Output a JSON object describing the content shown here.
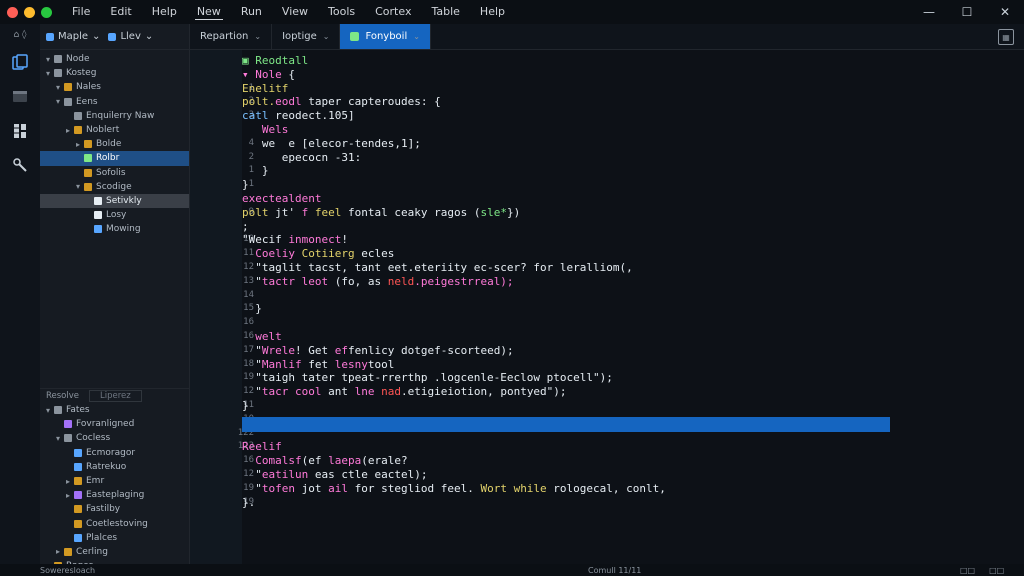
{
  "titlebar": {
    "menus": [
      "File",
      "Edit",
      "Help",
      "New",
      "Run",
      "View",
      "Tools",
      "Cortex",
      "Table",
      "Help"
    ],
    "active_menu_index": 3,
    "controls": [
      "—",
      "☐",
      "✕"
    ]
  },
  "activity": {
    "top_label": "⌂ ◊"
  },
  "sidebar": {
    "tab1": "Maple",
    "tab2": "Llev",
    "tree": [
      {
        "label": "Node",
        "depth": 0,
        "chev": "▾",
        "color": "#8b949e"
      },
      {
        "label": "Kosteg",
        "depth": 0,
        "chev": "▾",
        "color": "#8b949e"
      },
      {
        "label": "Nales",
        "depth": 1,
        "chev": "▾",
        "color": "#d29922"
      },
      {
        "label": "Eens",
        "depth": 1,
        "chev": "▾",
        "color": "#8b949e"
      },
      {
        "label": "Enquilerry Naw",
        "depth": 2,
        "chev": "",
        "color": "#8b949e"
      },
      {
        "label": "Noblert",
        "depth": 2,
        "chev": "▸",
        "color": "#d29922"
      },
      {
        "label": "Bolde",
        "depth": 3,
        "chev": "▸",
        "color": "#d29922"
      },
      {
        "label": "Rolbr",
        "depth": 3,
        "chev": "",
        "color": "#7ee787",
        "selected": true
      },
      {
        "label": "Sofolis",
        "depth": 3,
        "chev": "",
        "color": "#d29922"
      },
      {
        "label": "Scodige",
        "depth": 3,
        "chev": "▾",
        "color": "#d29922"
      },
      {
        "label": "Setivkly",
        "depth": 4,
        "chev": "",
        "color": "#e6edf3",
        "hover": true
      },
      {
        "label": "Losy",
        "depth": 4,
        "chev": "",
        "color": "#e6edf3"
      },
      {
        "label": "Mowing",
        "depth": 4,
        "chev": "",
        "color": "#58a6ff"
      }
    ],
    "outline_label": "Resolve",
    "outline_box": "Liperez",
    "outline_tree": [
      {
        "label": "Fates",
        "depth": 0,
        "chev": "▾",
        "color": "#8b949e"
      },
      {
        "label": "Fovranligned",
        "depth": 1,
        "chev": "",
        "color": "#a371f7"
      },
      {
        "label": "Cocless",
        "depth": 1,
        "chev": "▾",
        "color": "#8b949e"
      },
      {
        "label": "Ecmoragor",
        "depth": 2,
        "chev": "",
        "color": "#58a6ff"
      },
      {
        "label": "Ratrekuo",
        "depth": 2,
        "chev": "",
        "color": "#58a6ff"
      },
      {
        "label": "Emr",
        "depth": 2,
        "chev": "▸",
        "color": "#d29922"
      },
      {
        "label": "Easteplaging",
        "depth": 2,
        "chev": "▸",
        "color": "#a371f7"
      },
      {
        "label": "Fastilby",
        "depth": 2,
        "chev": "",
        "color": "#d29922"
      },
      {
        "label": "Coetlestoving",
        "depth": 2,
        "chev": "",
        "color": "#d29922"
      },
      {
        "label": "Plalces",
        "depth": 2,
        "chev": "",
        "color": "#58a6ff"
      },
      {
        "label": "Cerling",
        "depth": 1,
        "chev": "▸",
        "color": "#d29922"
      },
      {
        "label": "Roges",
        "depth": 0,
        "chev": "▸",
        "color": "#d29922"
      }
    ]
  },
  "tabs": [
    {
      "label": "Repartion",
      "active": false
    },
    {
      "label": "Ioptige",
      "active": false
    },
    {
      "label": "Fonyboil",
      "active": true
    }
  ],
  "editor": {
    "lines": [
      {
        "num": "",
        "indent": "",
        "parts": [
          {
            "t": "▣ Reodtall",
            "c": "c-green"
          }
        ]
      },
      {
        "num": "",
        "indent": "",
        "parts": [
          {
            "t": "▾ ",
            "c": "c-pink"
          },
          {
            "t": "Nole",
            "c": "c-pink"
          },
          {
            "t": " {",
            "c": "c-white"
          }
        ]
      },
      {
        "num": "1",
        "indent": "",
        "parts": [
          {
            "t": "Enelitf",
            "c": "c-yellow"
          }
        ]
      },
      {
        "num": "2",
        "indent": "",
        "parts": [
          {
            "t": "polt.",
            "c": "c-yellow"
          },
          {
            "t": "eodl",
            "c": "c-pink"
          },
          {
            "t": " taper capteroudes: {",
            "c": "c-white"
          }
        ]
      },
      {
        "num": "3",
        "indent": "",
        "parts": [
          {
            "t": "catl",
            "c": "c-blue"
          },
          {
            "t": " reodect.105]",
            "c": "c-white"
          }
        ]
      },
      {
        "num": "",
        "indent": "   ",
        "parts": [
          {
            "t": "Wels",
            "c": "c-pink"
          }
        ]
      },
      {
        "num": "4",
        "indent": "   ",
        "parts": [
          {
            "t": "we  e [elecor-tendes,1];",
            "c": "c-white"
          }
        ]
      },
      {
        "num": "2",
        "indent": "      ",
        "parts": [
          {
            "t": "epecocn -31:",
            "c": "c-white"
          }
        ]
      },
      {
        "num": "1",
        "indent": "   ",
        "parts": [
          {
            "t": "}",
            "c": "c-white"
          }
        ]
      },
      {
        "num": "1",
        "indent": "",
        "parts": [
          {
            "t": "}",
            "c": "c-white"
          }
        ]
      },
      {
        "num": "",
        "indent": "",
        "parts": [
          {
            "t": "exectealdent",
            "c": "c-pink"
          }
        ]
      },
      {
        "num": "9",
        "indent": "",
        "parts": [
          {
            "t": "polt",
            "c": "c-yellow"
          },
          {
            "t": " jt' ",
            "c": "c-white"
          },
          {
            "t": "f",
            "c": "c-pink"
          },
          {
            "t": " feel ",
            "c": "c-yellow"
          },
          {
            "t": "fontal ceaky ragos (",
            "c": "c-white"
          },
          {
            "t": "sle*",
            "c": "c-green"
          },
          {
            "t": "})",
            "c": "c-white"
          }
        ]
      },
      {
        "num": "",
        "indent": "",
        "parts": [
          {
            "t": ";",
            "c": "c-white"
          }
        ]
      },
      {
        "num": "10",
        "indent": "",
        "parts": [
          {
            "t": "\"Wecif",
            "c": "c-white"
          },
          {
            "t": " inmonect",
            "c": "c-pink"
          },
          {
            "t": "!",
            "c": "c-white"
          }
        ]
      },
      {
        "num": "11",
        "indent": "  ",
        "parts": [
          {
            "t": "Coeliy",
            "c": "c-pink"
          },
          {
            "t": " Cotiierg",
            "c": "c-yellow"
          },
          {
            "t": " ecles",
            "c": "c-white"
          }
        ]
      },
      {
        "num": "12",
        "indent": "  ",
        "parts": [
          {
            "t": "\"taglit tacst, tant eet.eteriity ec-scer? for leralliom(,",
            "c": "c-white"
          }
        ]
      },
      {
        "num": "13",
        "indent": "  ",
        "parts": [
          {
            "t": "\"",
            "c": "c-white"
          },
          {
            "t": "tactr leot",
            "c": "c-pink"
          },
          {
            "t": " (fo, as ",
            "c": "c-white"
          },
          {
            "t": "neld",
            "c": "c-red"
          },
          {
            "t": ".peigestrreal);",
            "c": "c-pink"
          }
        ]
      },
      {
        "num": "14",
        "indent": "",
        "parts": []
      },
      {
        "num": "15",
        "indent": "  ",
        "parts": [
          {
            "t": "}",
            "c": "c-white"
          }
        ]
      },
      {
        "num": "16",
        "indent": "",
        "parts": []
      },
      {
        "num": "16",
        "indent": "  ",
        "parts": [
          {
            "t": "welt",
            "c": "c-pink"
          }
        ]
      },
      {
        "num": "17",
        "indent": "  ",
        "parts": [
          {
            "t": "\"",
            "c": "c-white"
          },
          {
            "t": "Wrele",
            "c": "c-pink"
          },
          {
            "t": "! Get ",
            "c": "c-white"
          },
          {
            "t": "ef",
            "c": "c-pink"
          },
          {
            "t": "fenlicy dotgef-scorteed);",
            "c": "c-white"
          }
        ]
      },
      {
        "num": "18",
        "indent": "  ",
        "parts": [
          {
            "t": "\"",
            "c": "c-white"
          },
          {
            "t": "Manlif",
            "c": "c-pink"
          },
          {
            "t": " fet ",
            "c": "c-white"
          },
          {
            "t": "lesny",
            "c": "c-pink"
          },
          {
            "t": "tool",
            "c": "c-white"
          }
        ]
      },
      {
        "num": "19",
        "indent": "  ",
        "parts": [
          {
            "t": "\"taigh tater tpeat-rrerthp .logcenle-Eeclow ptocell\");",
            "c": "c-white"
          }
        ]
      },
      {
        "num": "12",
        "indent": "  ",
        "parts": [
          {
            "t": "\"",
            "c": "c-white"
          },
          {
            "t": "tacr cool",
            "c": "c-pink"
          },
          {
            "t": " ant ",
            "c": "c-white"
          },
          {
            "t": "lne",
            "c": "c-pink"
          },
          {
            "t": " ",
            "c": "c-white"
          },
          {
            "t": "nad",
            "c": "c-red"
          },
          {
            "t": ".etigieiotion, pontyed\");",
            "c": "c-white"
          }
        ]
      },
      {
        "num": "11",
        "indent": "",
        "parts": [
          {
            "t": "}",
            "c": "c-white"
          }
        ]
      },
      {
        "num": "10",
        "indent": "",
        "parts": []
      },
      {
        "num": "122",
        "indent": "",
        "parts": []
      },
      {
        "num": "123",
        "indent": "",
        "parts": [
          {
            "t": "Reelif",
            "c": "c-pink"
          }
        ]
      },
      {
        "num": "16",
        "indent": "  ",
        "parts": [
          {
            "t": "Comalsf",
            "c": "c-pink"
          },
          {
            "t": "(ef ",
            "c": "c-white"
          },
          {
            "t": "laepa",
            "c": "c-pink"
          },
          {
            "t": "(erale?",
            "c": "c-white"
          }
        ]
      },
      {
        "num": "12",
        "indent": "  ",
        "parts": [
          {
            "t": "\"",
            "c": "c-white"
          },
          {
            "t": "eatilun",
            "c": "c-pink"
          },
          {
            "t": " eas ctle eactel);",
            "c": "c-white"
          }
        ]
      },
      {
        "num": "19",
        "indent": "  ",
        "parts": [
          {
            "t": "\"",
            "c": "c-white"
          },
          {
            "t": "tofen",
            "c": "c-pink"
          },
          {
            "t": " jot ",
            "c": "c-white"
          },
          {
            "t": "ail",
            "c": "c-pink"
          },
          {
            "t": " for stegliod feel. ",
            "c": "c-white"
          },
          {
            "t": "Wort while",
            "c": "c-yellow"
          },
          {
            "t": " rologecal, conlt,",
            "c": "c-white"
          }
        ]
      },
      {
        "num": "19",
        "indent": "",
        "parts": [
          {
            "t": "}.",
            "c": "c-white"
          }
        ]
      }
    ]
  },
  "statusbar": {
    "left": "Soweresloach",
    "mid": "Comull 11/11",
    "right": [
      "□□",
      "□□"
    ]
  }
}
